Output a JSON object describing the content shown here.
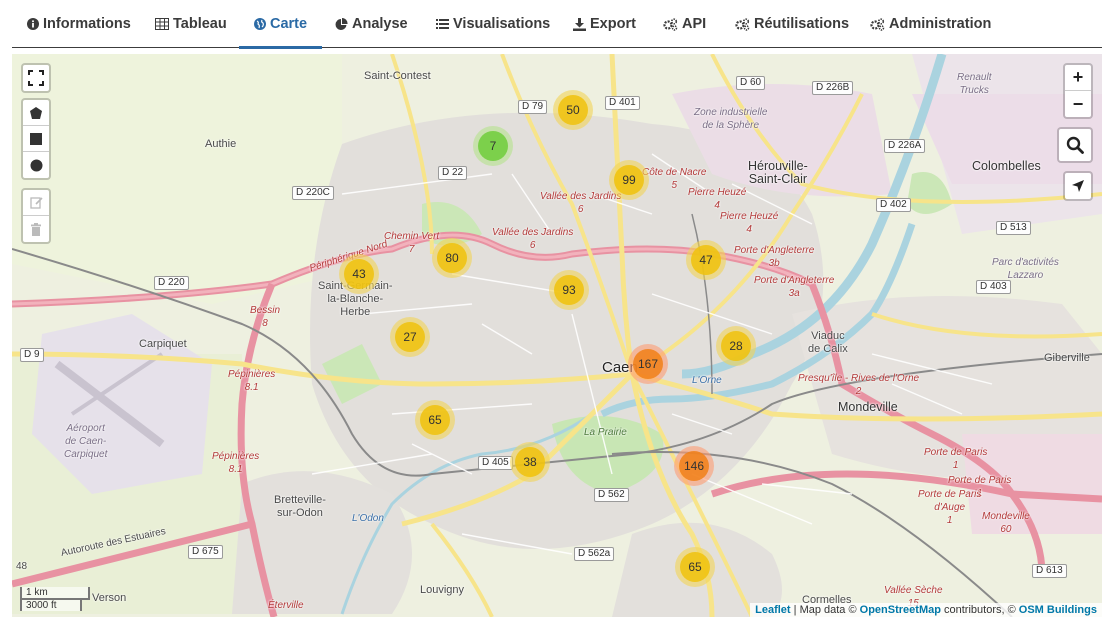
{
  "tabs": [
    {
      "label": "Informations",
      "icon": "info-circle-icon",
      "active": false
    },
    {
      "label": "Tableau",
      "icon": "table-icon",
      "active": false
    },
    {
      "label": "Carte",
      "icon": "globe-icon",
      "active": true
    },
    {
      "label": "Analyse",
      "icon": "pie-chart-icon",
      "active": false
    },
    {
      "label": "Visualisations",
      "icon": "list-icon",
      "active": false
    },
    {
      "label": "Export",
      "icon": "download-icon",
      "active": false
    },
    {
      "label": "API",
      "icon": "cogs-icon",
      "active": false
    },
    {
      "label": "Réutilisations",
      "icon": "cogs-icon",
      "active": false
    },
    {
      "label": "Administration",
      "icon": "cogs-icon",
      "active": false
    }
  ],
  "colors": {
    "accent": "#2b6aa5",
    "cluster_small": "#6ecc39",
    "cluster_medium": "#f0c20c",
    "cluster_large": "#f18017"
  },
  "map": {
    "places": {
      "saint_contest": "Saint-Contest",
      "authie": "Authie",
      "herouville": "Hérouville-\nSaint-Clair",
      "colombelles": "Colombelles",
      "saint_germain": "Saint-Germain-\nla-Blanche-\nHerbe",
      "carpiquet": "Carpiquet",
      "caen": "Caen",
      "mondeville": "Mondeville",
      "giberville": "Giberville",
      "bretteville": "Bretteville-\nsur-Odon",
      "louvigny": "Louvigny",
      "verson": "Verson",
      "cormelles": "Cormelles",
      "viaduc": "Viaduc\nde Calix",
      "zone_sphere": "Zone industrielle\nde la Sphère",
      "renault": "Renault\nTrucks",
      "parc_lazzaro": "Parc d'activités\nLazzaro",
      "aeroport": "Aéroport\nde Caen-\nCarpiquet",
      "prairie": "La Prairie",
      "orne": "L'Orne",
      "odon": "L'Odon"
    },
    "road_labels": {
      "vallee_jardins_6_a": "Vallée des Jardins\n6",
      "vallee_jardins_6_b": "Vallée des Jardins\n6",
      "chemin_vert": "Chemin Vert\n7",
      "peripherique_nord": "Périphérique Nord",
      "bessin": "Bessin\n8",
      "pepinieres_a": "Pépinières\n8.1",
      "pepinieres_b": "Pépinières\n8.1",
      "cote_nacre": "Côte de Nacre\n5",
      "pierre_heuze_a": "Pierre Heuzé\n4",
      "pierre_heuze_b": "Pierre Heuzé\n4",
      "porte_angleterre_a": "Porte d'Angleterre\n3b",
      "porte_angleterre_b": "Porte d'Angleterre\n3a",
      "presquile": "Presqu'île - Rives de l'Orne\n2",
      "porte_paris_a": "Porte de Paris\n1",
      "porte_paris_b": "Porte de Paris\n1",
      "porte_paris_c": "Porte de Paris\nd'Auge\n1",
      "mondeville_rd": "Mondeville\n60",
      "vallee_seche": "Vallée Sèche\n15",
      "eterville": "Éterville",
      "autoroute": "Autoroute des Estuaires",
      "n48": "48"
    },
    "road_shields": [
      "D 60",
      "D 79",
      "D 401",
      "D 226B",
      "D 22",
      "D 220C",
      "D 226A",
      "D 402",
      "D 513",
      "D 220",
      "D 403",
      "D 9",
      "D 405",
      "D 562",
      "D 675",
      "D 562a",
      "D 613"
    ],
    "clusters": [
      {
        "count": "7",
        "size": "small"
      },
      {
        "count": "50",
        "size": "medium"
      },
      {
        "count": "99",
        "size": "medium"
      },
      {
        "count": "80",
        "size": "medium"
      },
      {
        "count": "43",
        "size": "medium"
      },
      {
        "count": "93",
        "size": "medium"
      },
      {
        "count": "47",
        "size": "medium"
      },
      {
        "count": "27",
        "size": "medium"
      },
      {
        "count": "28",
        "size": "medium"
      },
      {
        "count": "167",
        "size": "large"
      },
      {
        "count": "65",
        "size": "medium"
      },
      {
        "count": "38",
        "size": "medium"
      },
      {
        "count": "146",
        "size": "large"
      },
      {
        "count": "65",
        "size": "medium"
      }
    ],
    "controls": {
      "zoom_in": "+",
      "zoom_out": "−",
      "fullscreen_icon": "fullscreen-icon",
      "draw_tools": [
        "polygon-icon",
        "rectangle-icon",
        "circle-icon"
      ],
      "edit_tools": [
        "edit-icon",
        "trash-icon"
      ],
      "search_icon": "search-icon",
      "locate_icon": "locate-arrow-icon"
    },
    "scale": {
      "metric": "1 km",
      "imperial": "3000 ft"
    },
    "attribution": {
      "leaflet": "Leaflet",
      "text1": " | Map data © ",
      "osm": "OpenStreetMap",
      "text2": " contributors, © ",
      "osmb": "OSM Buildings"
    }
  }
}
